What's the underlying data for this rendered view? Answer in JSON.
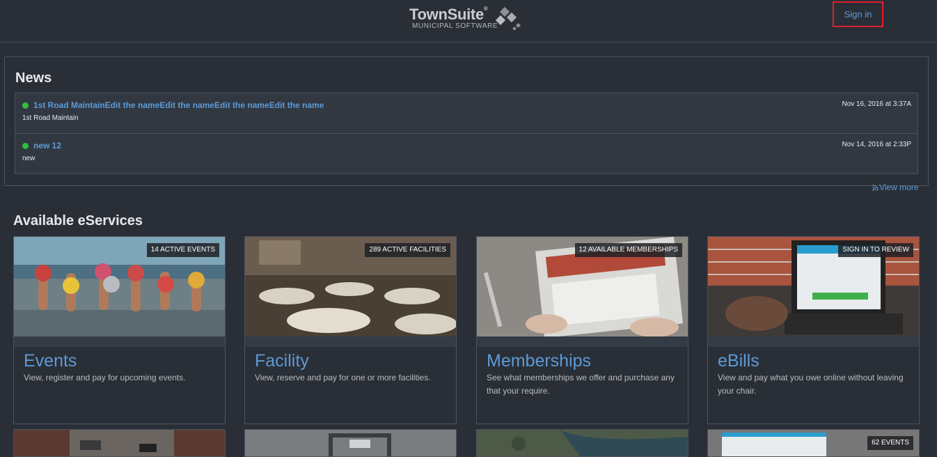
{
  "header": {
    "logo_name": "TownSuite",
    "logo_reg": "®",
    "logo_tagline": "MUNICIPAL SOFTWARE",
    "signin_label": "Sign in"
  },
  "news": {
    "title": "News",
    "items": [
      {
        "title": "1st Road MaintainEdit the nameEdit the nameEdit the nameEdit the name",
        "description": "1st Road Maintain",
        "date": "Nov 16, 2016 at 3:37A"
      },
      {
        "title": "new 12",
        "description": "new",
        "date": "Nov 14, 2016 at 2:33P"
      }
    ],
    "view_more": "View more",
    "status_color": "#2fc13d"
  },
  "services": {
    "title": "Available eServices",
    "cards": [
      {
        "badge": "14 ACTIVE EVENTS",
        "title": "Events",
        "description": "View, register and pay for upcoming events."
      },
      {
        "badge": "289 ACTIVE FACILITIES",
        "title": "Facility",
        "description": "View, reserve and pay for one or more facilities."
      },
      {
        "badge": "12 AVAILABLE MEMBERSHIPS",
        "title": "Memberships",
        "description": "See what memberships we offer and purchase any that your require."
      },
      {
        "badge": "SIGN IN TO REVIEW",
        "title": "eBills",
        "description": "View and pay what you owe online without leaving your chair."
      }
    ],
    "second_row": [
      {
        "badge": ""
      },
      {
        "badge": ""
      },
      {
        "badge": ""
      },
      {
        "badge": "62 EVENTS"
      }
    ]
  },
  "colors": {
    "background": "#2a2f37",
    "accent": "#5d9ad6",
    "highlight_border": "#e0202a"
  }
}
